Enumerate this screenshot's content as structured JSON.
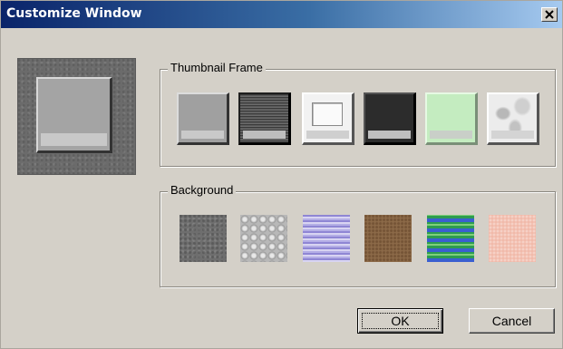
{
  "window": {
    "title": "Customize Window",
    "title_bar_gradient": [
      "#0a246a",
      "#a6caf0"
    ],
    "face_color": "#d4d0c8"
  },
  "groups": {
    "thumbnail_frame": {
      "label": "Thumbnail Frame",
      "options": [
        {
          "name": "gray",
          "color": "#a0a0a0"
        },
        {
          "name": "dark-stripes",
          "color": "#4a4a4a"
        },
        {
          "name": "white",
          "color": "#f2f2f2"
        },
        {
          "name": "black",
          "color": "#2c2c2c"
        },
        {
          "name": "light-green",
          "color": "#c4ecc0"
        },
        {
          "name": "marble",
          "color": "#ececec"
        }
      ]
    },
    "background": {
      "label": "Background",
      "options": [
        {
          "name": "granite",
          "color": "#6e6e6e"
        },
        {
          "name": "studs",
          "color": "#b8b8b8"
        },
        {
          "name": "lavender-stripes",
          "color": "#b4aee6"
        },
        {
          "name": "wood",
          "color": "#8c6a48"
        },
        {
          "name": "blue-green-wave",
          "color": "#2e9c4f"
        },
        {
          "name": "pink-texture",
          "color": "#f1b9a8"
        }
      ]
    }
  },
  "buttons": {
    "ok_label": "OK",
    "cancel_label": "Cancel"
  },
  "icons": {
    "close": "close-icon"
  }
}
